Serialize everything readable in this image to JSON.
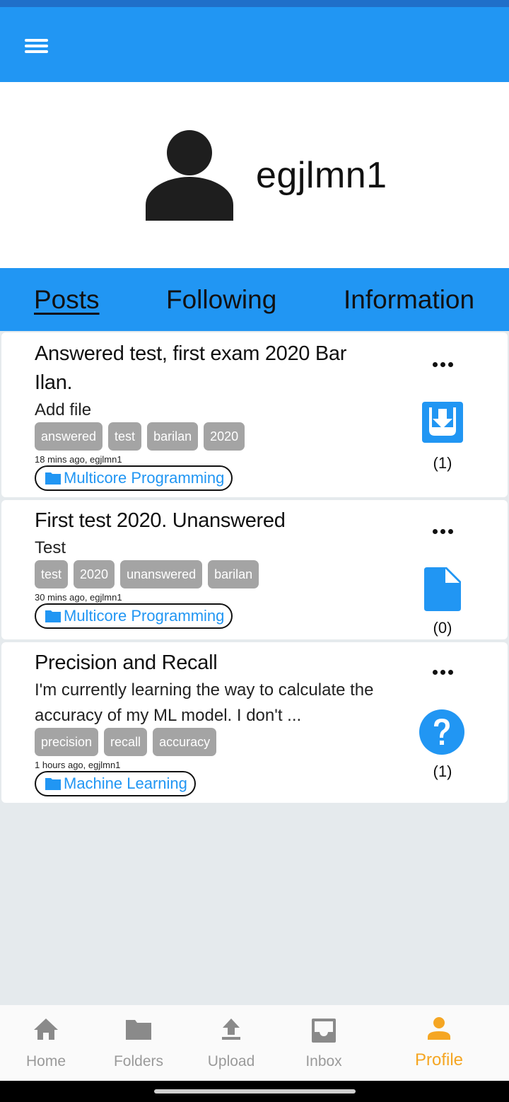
{
  "profile": {
    "username": "egjlmn1"
  },
  "tabs": [
    {
      "label": "Posts",
      "active": true
    },
    {
      "label": "Following",
      "active": false
    },
    {
      "label": "Information",
      "active": false
    }
  ],
  "posts": [
    {
      "title": "Answered test, first exam 2020 Bar Ilan.",
      "body": "Add file",
      "tags": [
        "answered",
        "test",
        "barilan",
        "2020"
      ],
      "meta": "18 mins ago, egjlmn1",
      "folder": "Multicore Programming",
      "icon": "file-download-icon",
      "count": "(1)"
    },
    {
      "title": "First test 2020. Unanswered",
      "body": "Test",
      "tags": [
        "test",
        "2020",
        "unanswered",
        "barilan"
      ],
      "meta": "30 mins ago, egjlmn1",
      "folder": "Multicore Programming",
      "icon": "document-icon",
      "count": "(0)"
    },
    {
      "title": "Precision and Recall",
      "body": "I'm currently learning the way to calculate the accuracy of my ML model. I don't ...",
      "tags": [
        "precision",
        "recall",
        "accuracy"
      ],
      "meta": "1 hours ago, egjlmn1",
      "folder": "Machine Learning",
      "icon": "question-icon",
      "count": "(1)"
    }
  ],
  "nav": [
    {
      "label": "Home",
      "icon": "home-icon",
      "active": false
    },
    {
      "label": "Folders",
      "icon": "folder-icon",
      "active": false
    },
    {
      "label": "Upload",
      "icon": "upload-icon",
      "active": false
    },
    {
      "label": "Inbox",
      "icon": "inbox-icon",
      "active": false
    },
    {
      "label": "Profile",
      "icon": "person-icon",
      "active": true
    }
  ],
  "colors": {
    "primary": "#2196f3",
    "active_nav": "#f5a623",
    "tag_bg": "#a4a4a4",
    "background": "#e5eaed"
  }
}
